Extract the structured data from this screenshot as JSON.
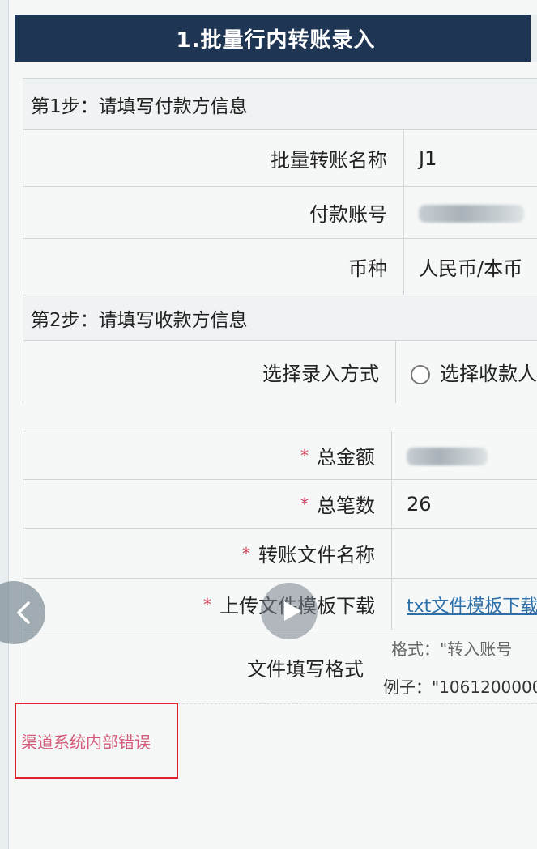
{
  "header": {
    "title": "1.批量行内转账录入"
  },
  "step1": {
    "label": "第1步：请填写付款方信息",
    "fields": {
      "batch_name_label": "批量转账名称",
      "batch_name_value": "J1",
      "account_label": "付款账号",
      "currency_label": "币种",
      "currency_value": "人民币/本币"
    }
  },
  "step2": {
    "label": "第2步：请填写收款方信息",
    "entry_method_label": "选择录入方式",
    "entry_method_option": "选择收款人",
    "total_amount_label": "总金额",
    "total_count_label": "总笔数",
    "total_count_value": "26",
    "file_name_label": "转账文件名称",
    "upload_label": "上传文件",
    "template_label": "模板下载",
    "template_link": "txt文件模板下载",
    "format_label": "文件填写格式",
    "format_line": "格式：\"转入账号",
    "example_line": "例子：\"1061200000"
  },
  "required_mark": "*",
  "error": {
    "message": "渠道系统内部错误"
  },
  "icons": {
    "prev": "chevron-left-icon",
    "play": "play-icon",
    "radio": "radio-unchecked-icon"
  },
  "colors": {
    "title_bg": "#1f3554",
    "error_border": "#e0232e",
    "error_text": "#d45a7a",
    "link": "#2d6fa8",
    "required": "#d23a5a"
  }
}
